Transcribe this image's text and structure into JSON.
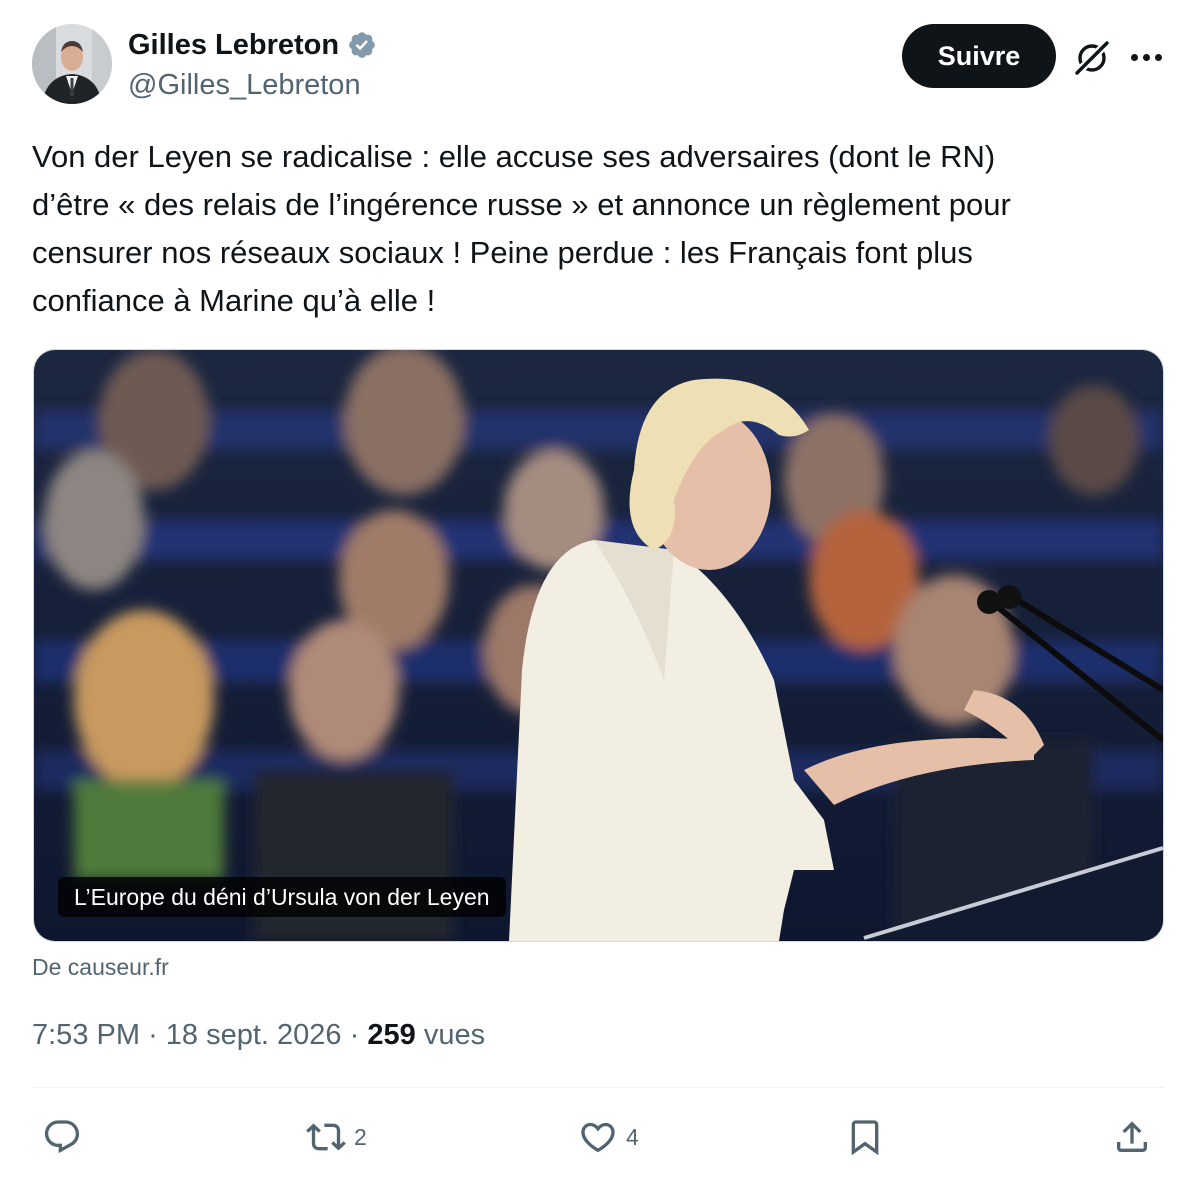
{
  "author": {
    "name": "Gilles Lebreton",
    "handle": "@Gilles_Lebreton",
    "verified_icon": "verified-badge-icon"
  },
  "header": {
    "follow_label": "Suivre",
    "icons": [
      "grok-icon",
      "more-icon"
    ]
  },
  "tweet": {
    "text": "Von der Leyen se radicalise : elle accuse ses adversaires (dont le RN)\nd’être « des relais de l’ingérence russe » et annonce un règlement pour\ncensurer nos réseaux sociaux ! Peine perdue : les Français font plus\nconfiance à Marine qu’à elle !"
  },
  "card": {
    "caption": "L’Europe du déni d’Ursula von der Leyen",
    "source": "De causeur.fr"
  },
  "meta": {
    "time": "7:53 PM",
    "separator": "·",
    "date": "18 sept. 2026",
    "views_count": "259",
    "views_label": "vues"
  },
  "actions": {
    "reply": {
      "icon": "reply-icon",
      "count": ""
    },
    "retweet": {
      "icon": "retweet-icon",
      "count": "2"
    },
    "like": {
      "icon": "heart-icon",
      "count": "4"
    },
    "bookmark": {
      "icon": "bookmark-icon",
      "count": ""
    },
    "share": {
      "icon": "share-icon",
      "count": ""
    }
  },
  "colors": {
    "text": "#0f1419",
    "secondary": "#536471",
    "verified": "#829aab",
    "button_bg": "#0f1419",
    "divider": "#eff3f4"
  }
}
